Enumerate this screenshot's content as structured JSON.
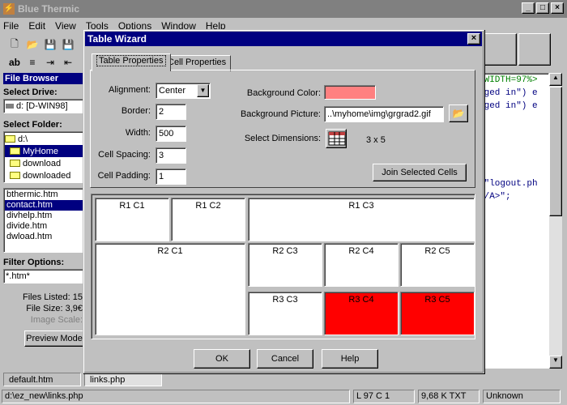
{
  "app": {
    "title": "Blue Thermic"
  },
  "menu": [
    "File",
    "Edit",
    "View",
    "Tools",
    "Options",
    "Window",
    "Help"
  ],
  "file_browser": {
    "title": "File Browser",
    "drive_label": "Select Drive:",
    "drive_value": "d: [D-WIN98]",
    "folder_label": "Select Folder:",
    "folders": [
      "d:\\",
      "MyHome",
      "download",
      "downloaded"
    ],
    "selected_folder": "MyHome",
    "files": [
      "bthermic.htm",
      "contact.htm",
      "divhelp.htm",
      "divide.htm",
      "dwload.htm"
    ],
    "selected_file": "contact.htm",
    "filter_label": "Filter Options:",
    "filter_value": "*.htm*",
    "files_listed": "Files Listed: 15",
    "file_size": "File Size: 3,9€",
    "image_scale": "Image Scale:",
    "preview_button": "Preview Mode"
  },
  "editor": {
    "lines": [
      " WIDTH=97%>",
      "gged in\") e",
      "gged in\") e",
      "",
      "",
      "",
      "",
      "",
      "\\\"logout.ph",
      "</A>\";"
    ]
  },
  "doc_tabs": [
    "default.htm",
    "links.php"
  ],
  "status": {
    "path": "d:\\ez_new\\links.php",
    "position": "L 97  C 1",
    "size": "9,68 K  TXT",
    "encoding": "Unknown"
  },
  "dialog": {
    "title": "Table Wizard",
    "tabs": [
      "Table Properties",
      "Cell Properties"
    ],
    "alignment_label": "Alignment:",
    "alignment_value": "Center",
    "border_label": "Border:",
    "border_value": "2",
    "width_label": "Width:",
    "width_value": "500",
    "spacing_label": "Cell Spacing:",
    "spacing_value": "3",
    "padding_label": "Cell Padding:",
    "padding_value": "1",
    "bg_color_label": "Background Color:",
    "bg_color": "#ff8080",
    "bg_picture_label": "Background Picture:",
    "bg_picture_value": "..\\myhome\\img\\grgrad2.gif",
    "dimensions_label": "Select Dimensions:",
    "dimensions_value": "3 x 5",
    "join_button": "Join Selected Cells",
    "cells": [
      "R1 C1",
      "R1 C2",
      "R1 C3",
      "R2 C1",
      "R2 C3",
      "R2 C4",
      "R2 C5",
      "R3 C3",
      "R3 C4",
      "R3 C5"
    ],
    "ok": "OK",
    "cancel": "Cancel",
    "help": "Help"
  }
}
